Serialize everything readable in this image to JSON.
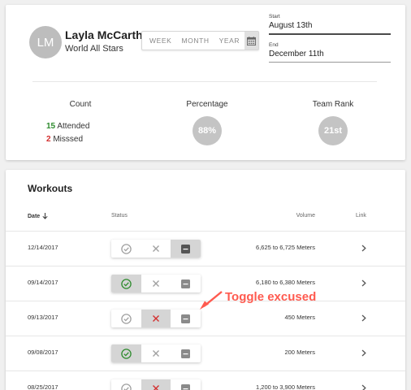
{
  "profile": {
    "initials": "LM",
    "name": "Layla McCarthy",
    "team": "World All Stars"
  },
  "date_range": {
    "options": [
      "WEEK",
      "MONTH",
      "YEAR"
    ],
    "calendar_icon": "calendar-icon"
  },
  "start": {
    "label": "Start",
    "value": "August 13th"
  },
  "end": {
    "label": "End",
    "value": "December 11th"
  },
  "stats": {
    "count": {
      "title": "Count",
      "attended_num": "15",
      "attended_text": "Attended",
      "missed_num": "2",
      "missed_text": "Misssed"
    },
    "percentage": {
      "title": "Percentage",
      "value": "88%"
    },
    "rank": {
      "title": "Team Rank",
      "value": "21st"
    }
  },
  "workouts": {
    "title": "Workouts",
    "columns": {
      "date": "Date",
      "status": "Status",
      "volume": "Volume",
      "link": "Link"
    },
    "sort_icon": "arrow-down-icon",
    "rows": [
      {
        "date": "12/14/2017",
        "status": "excused",
        "volume": "6,625 to 6,725 Meters"
      },
      {
        "date": "09/14/2017",
        "status": "attended",
        "volume": "6,180 to 6,380 Meters"
      },
      {
        "date": "09/13/2017",
        "status": "missed",
        "volume": "450 Meters"
      },
      {
        "date": "09/08/2017",
        "status": "attended",
        "volume": "200 Meters"
      },
      {
        "date": "08/25/2017",
        "status": "missed",
        "volume": "1,200 to 3,900 Meters"
      }
    ]
  },
  "annotation": {
    "text": "Toggle excused"
  },
  "colors": {
    "accent_green": "#2e8b2e",
    "accent_red": "#d32f2f",
    "annotation": "#ff5a4f",
    "toggle_active_bg": "#d5d5d5"
  }
}
